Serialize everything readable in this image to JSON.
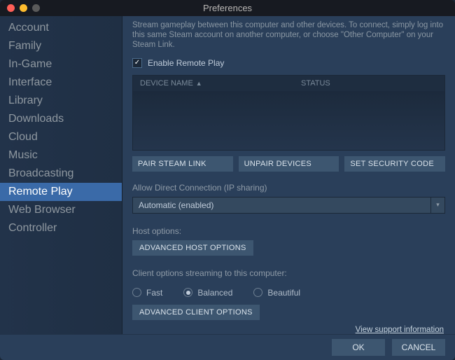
{
  "window": {
    "title": "Preferences"
  },
  "sidebar": {
    "items": [
      {
        "label": "Account",
        "active": false
      },
      {
        "label": "Family",
        "active": false
      },
      {
        "label": "In-Game",
        "active": false
      },
      {
        "label": "Interface",
        "active": false
      },
      {
        "label": "Library",
        "active": false
      },
      {
        "label": "Downloads",
        "active": false
      },
      {
        "label": "Cloud",
        "active": false
      },
      {
        "label": "Music",
        "active": false
      },
      {
        "label": "Broadcasting",
        "active": false
      },
      {
        "label": "Remote Play",
        "active": true
      },
      {
        "label": "Web Browser",
        "active": false
      },
      {
        "label": "Controller",
        "active": false
      }
    ]
  },
  "main": {
    "description": "Stream gameplay between this computer and other devices. To connect, simply log into this same Steam account on another computer, or choose \"Other Computer\" on your Steam Link.",
    "enable_checkbox": {
      "label": "Enable Remote Play",
      "checked": true
    },
    "table": {
      "columns": {
        "device": "DEVICE NAME",
        "status": "STATUS"
      },
      "sort_indicator": "▲"
    },
    "buttons": {
      "pair": "PAIR STEAM LINK",
      "unpair": "UNPAIR DEVICES",
      "security": "SET SECURITY CODE"
    },
    "direct_conn": {
      "label": "Allow Direct Connection (IP sharing)",
      "value": "Automatic (enabled)"
    },
    "host": {
      "label": "Host options:",
      "button": "ADVANCED HOST OPTIONS"
    },
    "client": {
      "label": "Client options streaming to this computer:",
      "options": [
        {
          "label": "Fast",
          "selected": false
        },
        {
          "label": "Balanced",
          "selected": true
        },
        {
          "label": "Beautiful",
          "selected": false
        }
      ],
      "button": "ADVANCED CLIENT OPTIONS"
    },
    "support_link": "View support information"
  },
  "footer": {
    "ok": "OK",
    "cancel": "CANCEL"
  }
}
